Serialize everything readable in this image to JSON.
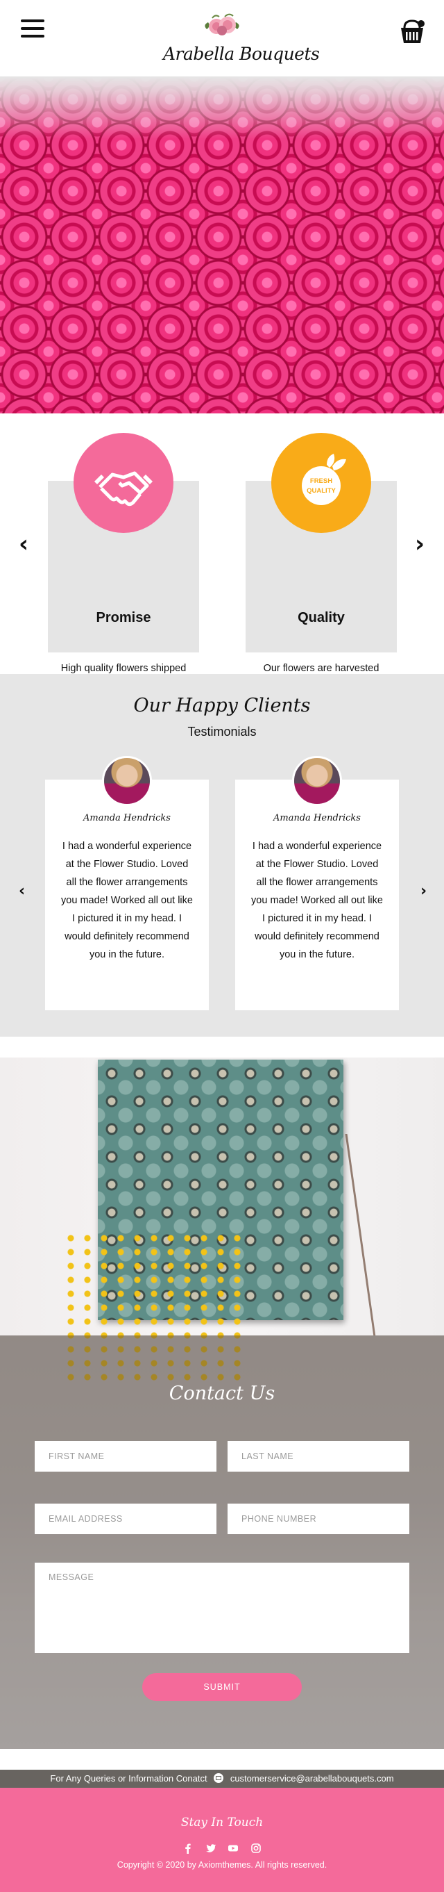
{
  "header": {
    "logo_text": "Arabella Bouquets"
  },
  "features": [
    {
      "title": "Promise",
      "text": "High quality flowers shipped directly from our farm.",
      "icon": "handshake-icon",
      "color": "#f46a9a"
    },
    {
      "title": "Quality",
      "text": "Our flowers are harvested the day they are shipped!",
      "icon": "fresh-quality-badge-icon",
      "badge_text": "FRESH QUALITY",
      "color": "#f9ab18"
    }
  ],
  "carousel": {
    "prev": "‹",
    "next": "›"
  },
  "testimonials": {
    "title": "Our Happy Clients",
    "subtitle": "Testimonials",
    "items": [
      {
        "name": "Amanda Hendricks",
        "text": "I had a wonderful experience at the Flower Studio. Loved all the flower arrangements you made! Worked all out like I pictured it in my head. I would definitely recommend you in the future."
      },
      {
        "name": "Amanda Hendricks",
        "text": "I had a wonderful experience at the Flower Studio. Loved all the flower arrangements you made! Worked all out like I pictured it in my head. I would definitely recommend you in the future."
      }
    ]
  },
  "contact": {
    "title": "Contact Us",
    "first_name_placeholder": "FIRST NAME",
    "last_name_placeholder": "LAST NAME",
    "email_placeholder": "EMAIL ADDRESS",
    "phone_placeholder": "PHONE NUMBER",
    "message_placeholder": "MESSAGE",
    "submit_label": "SUBMIT"
  },
  "infobar": {
    "text": "For Any Queries or Information Conatct",
    "email": "customerservice@arabellabouquets.com"
  },
  "footer": {
    "stay_in_touch": "Stay In Touch",
    "social_icons": [
      "facebook-icon",
      "twitter-icon",
      "youtube-icon",
      "instagram-icon"
    ],
    "copyright": "Copyright © 2020 by Axiomthemes. All rights reserved."
  },
  "colors": {
    "accent_pink": "#f46a9a",
    "accent_orange": "#f9ab18",
    "info_bar": "#686460",
    "section_gray": "#e6e6e6"
  }
}
